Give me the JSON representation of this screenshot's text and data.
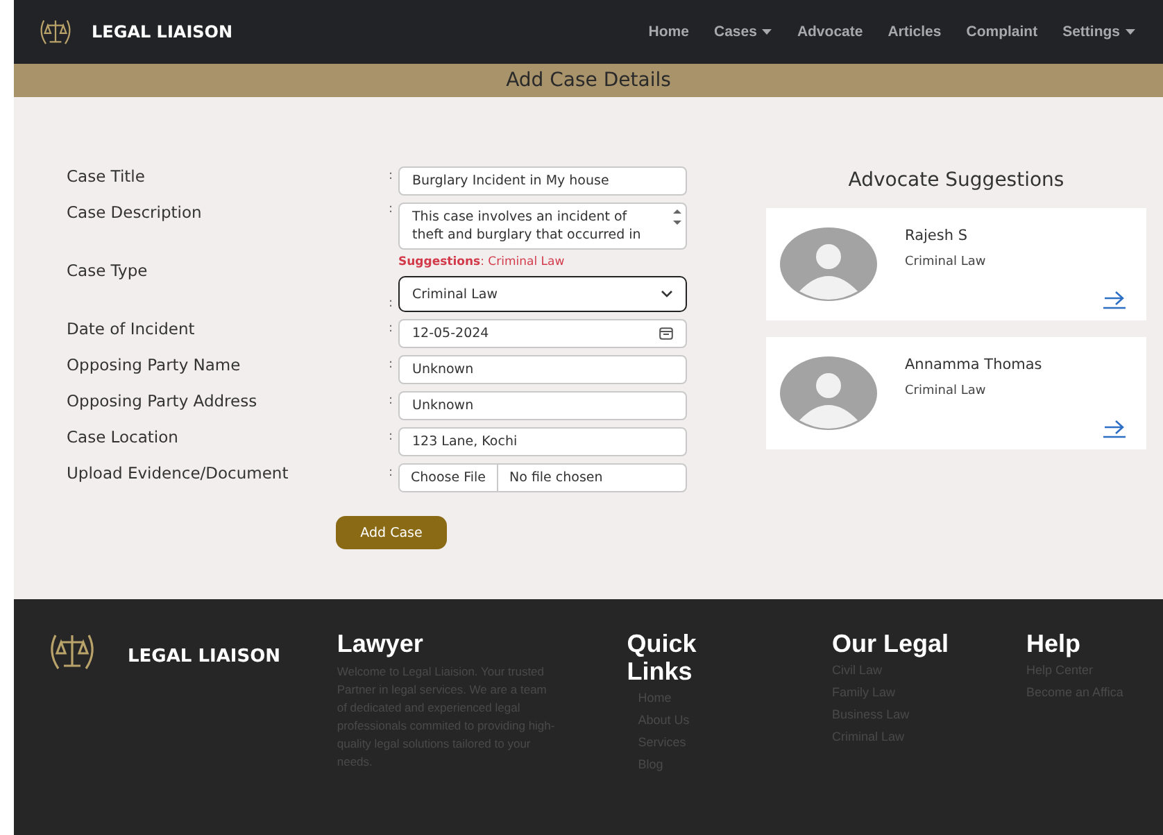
{
  "nav": {
    "brand": "LEGAL LIAISON",
    "items": [
      {
        "label": "Home",
        "dropdown": false
      },
      {
        "label": "Cases",
        "dropdown": true
      },
      {
        "label": "Advocate",
        "dropdown": false
      },
      {
        "label": "Articles",
        "dropdown": false
      },
      {
        "label": "Complaint",
        "dropdown": false
      },
      {
        "label": "Settings",
        "dropdown": true
      }
    ]
  },
  "page_title": "Add Case Details",
  "form": {
    "fields": [
      {
        "kind": "text",
        "label": "Case Title",
        "value": "Burglary Incident in My house"
      },
      {
        "kind": "textarea",
        "label": "Case Description",
        "value": "This case involves an incident of theft and burglary that occurred in"
      },
      {
        "kind": "select",
        "label": "Case Type",
        "value": "Criminal Law",
        "suggestion": "**Suggestions**: Criminal Law"
      },
      {
        "kind": "date",
        "label": "Date of Incident",
        "value": "12-05-2024"
      },
      {
        "kind": "text",
        "label": "Opposing Party Name",
        "value": "Unknown"
      },
      {
        "kind": "text",
        "label": "Opposing Party Address",
        "value": "Unknown"
      },
      {
        "kind": "text",
        "label": "Case Location",
        "value": "123 Lane, Kochi"
      },
      {
        "kind": "file",
        "label": "Upload Evidence/Document",
        "button": "Choose File",
        "value": "No file chosen"
      }
    ],
    "separator": ":",
    "submit": "Add Case"
  },
  "advocates": {
    "title": "Advocate Suggestions",
    "items": [
      {
        "name": "Rajesh S",
        "specialty": "Criminal Law"
      },
      {
        "name": "Annamma Thomas",
        "specialty": "Criminal Law"
      }
    ]
  },
  "footer": {
    "brand": "LEGAL LIAISON",
    "about": {
      "title": "Lawyer",
      "text": "Welcome to Legal Liaision. Your trusted Partner in legal services. We are a team of dedicated and experienced legal professionals commited to providing high-quality legal solutions tailored to your needs."
    },
    "columns": [
      {
        "title": "Quick Links",
        "links": [
          "Home",
          "About Us",
          "Services",
          "Blog"
        ]
      },
      {
        "title": "Our Legal",
        "links": [
          "Civil Law",
          "Family Law",
          "Business Law",
          "Criminal Law"
        ]
      },
      {
        "title": "Help",
        "links": [
          "Help Center",
          "Become an Affica"
        ]
      }
    ]
  }
}
